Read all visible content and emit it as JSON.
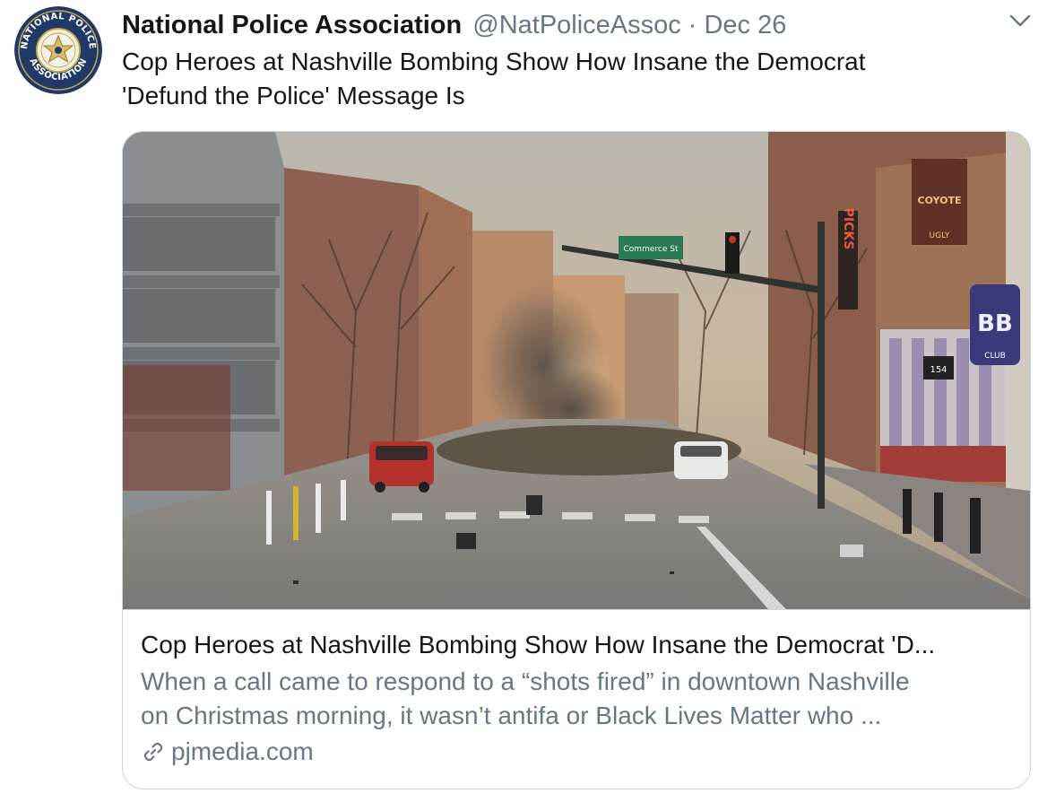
{
  "tweet": {
    "author_name": "National Police Association",
    "handle": "@NatPoliceAssoc",
    "separator": "·",
    "date": "Dec 26",
    "text_lines": [
      "Cop Heroes at Nashville Bombing Show How Insane the Democrat",
      "'Defund the Police' Message Is"
    ],
    "avatar": {
      "icon": "police-badge-logo",
      "text_top": "NATIONAL POLICE",
      "text_bottom": "ASSOCIATION"
    },
    "menu_icon": "chevron-down-icon"
  },
  "card": {
    "image": {
      "street_sign": "Commerce St",
      "sign_1": "PICKS",
      "sign_2": "COYOTE",
      "sign_2_sub": "UGLY",
      "sign_3": "BB",
      "sign_3_sub": "CLUB",
      "address_plate": "154"
    },
    "title": "Cop Heroes at Nashville Bombing Show How Insane the Democrat 'D...",
    "description_lines": [
      "When a call came to respond to a “shots fired” in downtown Nashville",
      "on Christmas morning, it wasn’t antifa or Black Lives Matter who ..."
    ],
    "domain": "pjmedia.com",
    "domain_icon": "link-icon"
  },
  "colors": {
    "text_primary": "#14171a",
    "text_secondary": "#657786",
    "border": "#ccd6dd",
    "avatar_navy": "#1f3a68",
    "avatar_gold": "#c9a64a"
  }
}
